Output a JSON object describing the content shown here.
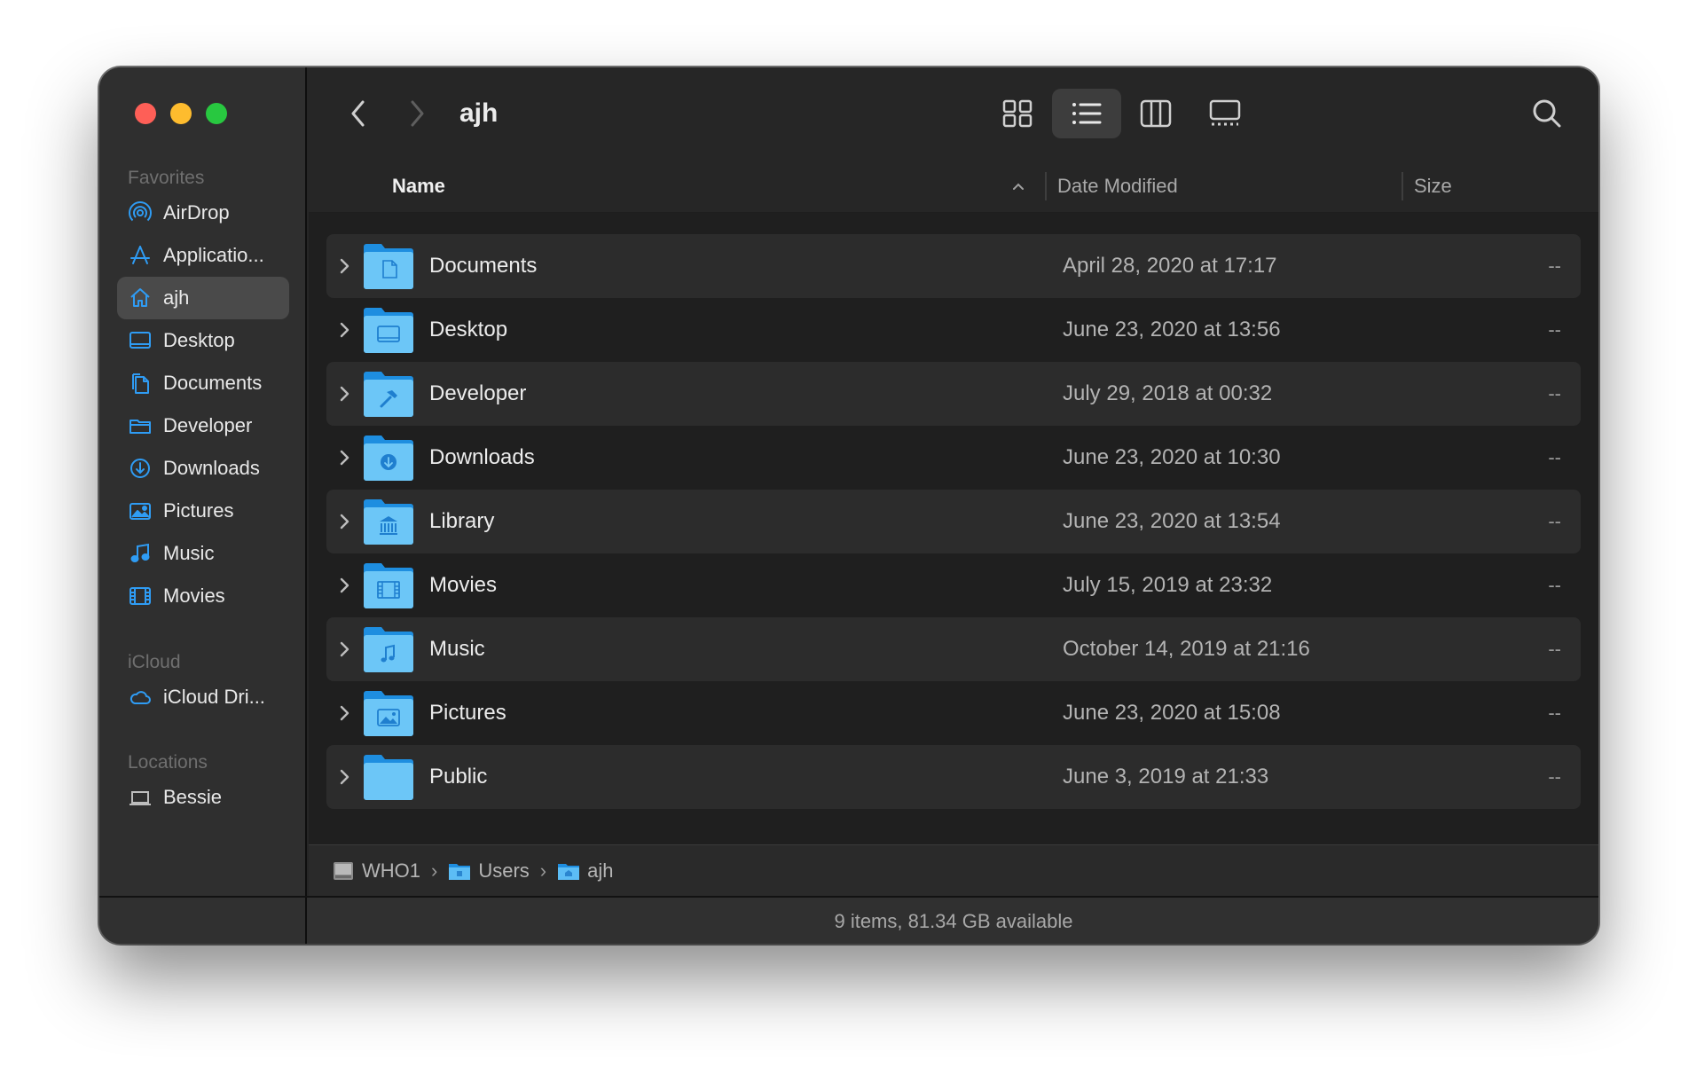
{
  "window": {
    "title": "ajh"
  },
  "sidebar": {
    "sections": [
      {
        "heading": "Favorites",
        "items": [
          {
            "label": "AirDrop",
            "icon": "airdrop-icon"
          },
          {
            "label": "Applicatio...",
            "icon": "applications-icon"
          },
          {
            "label": "ajh",
            "icon": "home-icon",
            "active": true
          },
          {
            "label": "Desktop",
            "icon": "desktop-icon"
          },
          {
            "label": "Documents",
            "icon": "documents-icon"
          },
          {
            "label": "Developer",
            "icon": "folder-icon"
          },
          {
            "label": "Downloads",
            "icon": "downloads-icon"
          },
          {
            "label": "Pictures",
            "icon": "pictures-icon"
          },
          {
            "label": "Music",
            "icon": "music-icon"
          },
          {
            "label": "Movies",
            "icon": "movies-icon"
          }
        ]
      },
      {
        "heading": "iCloud",
        "items": [
          {
            "label": "iCloud Dri...",
            "icon": "cloud-icon"
          }
        ]
      },
      {
        "heading": "Locations",
        "items": [
          {
            "label": "Bessie",
            "icon": "laptop-icon"
          }
        ]
      }
    ]
  },
  "toolbar": {
    "view_modes": [
      "icon-view",
      "list-view",
      "column-view",
      "gallery-view"
    ],
    "active_view": "list-view"
  },
  "columns": {
    "name": "Name",
    "date": "Date Modified",
    "size": "Size"
  },
  "files": [
    {
      "name": "Documents",
      "date": "April 28, 2020 at 17:17",
      "size": "--",
      "glyph": "document-glyph"
    },
    {
      "name": "Desktop",
      "date": "June 23, 2020 at 13:56",
      "size": "--",
      "glyph": "desktop-glyph"
    },
    {
      "name": "Developer",
      "date": "July 29, 2018 at 00:32",
      "size": "--",
      "glyph": "hammer-glyph"
    },
    {
      "name": "Downloads",
      "date": "June 23, 2020 at 10:30",
      "size": "--",
      "glyph": "download-glyph"
    },
    {
      "name": "Library",
      "date": "June 23, 2020 at 13:54",
      "size": "--",
      "glyph": "library-glyph"
    },
    {
      "name": "Movies",
      "date": "July 15, 2019 at 23:32",
      "size": "--",
      "glyph": "film-glyph"
    },
    {
      "name": "Music",
      "date": "October 14, 2019 at 21:16",
      "size": "--",
      "glyph": "music-glyph"
    },
    {
      "name": "Pictures",
      "date": "June 23, 2020 at 15:08",
      "size": "--",
      "glyph": "picture-glyph"
    },
    {
      "name": "Public",
      "date": "June 3, 2019 at 21:33",
      "size": "--",
      "glyph": "none"
    }
  ],
  "pathbar": {
    "crumbs": [
      {
        "label": "WHO1",
        "icon": "hard-drive-icon"
      },
      {
        "label": "Users",
        "icon": "folder-icon"
      },
      {
        "label": "ajh",
        "icon": "home-folder-icon"
      }
    ]
  },
  "status": {
    "text": "9 items, 81.34 GB available"
  },
  "colors": {
    "accent": "#2f9cf4",
    "folder_light": "#6cc6f7",
    "folder_dark": "#1e8ee0"
  }
}
